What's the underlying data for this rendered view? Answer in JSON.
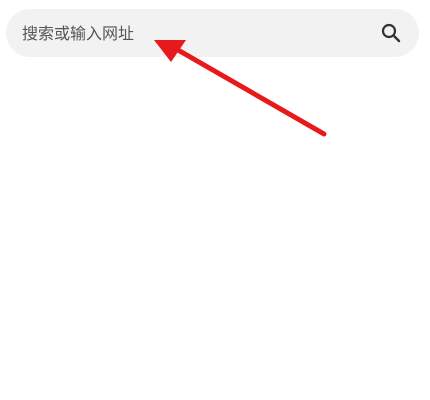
{
  "search": {
    "placeholder": "搜索或输入网址",
    "value": "",
    "icon": "search-icon"
  },
  "annotation": {
    "type": "arrow",
    "color": "#e8191c"
  }
}
